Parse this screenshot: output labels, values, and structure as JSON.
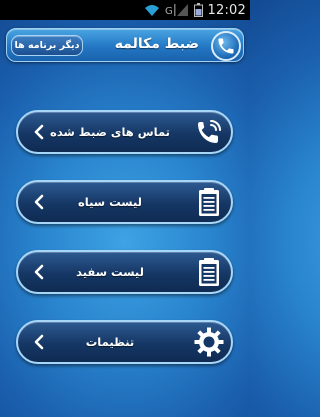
{
  "status_bar": {
    "time": "12:02",
    "icons": [
      "wifi-icon",
      "signal-icon",
      "battery-icon"
    ]
  },
  "header": {
    "title": "ضبط مکالمه",
    "more_apps_label": "دیگر برنامه ها",
    "logo_icon": "phone-logo-icon"
  },
  "menu": {
    "items": [
      {
        "label": "تماس های ضبط شده",
        "icon": "phone-icon"
      },
      {
        "label": "لیست سیاه",
        "icon": "clipboard-icon"
      },
      {
        "label": "لیست سفید",
        "icon": "clipboard-icon"
      },
      {
        "label": "تنظیمات",
        "icon": "gear-icon"
      }
    ]
  },
  "colors": {
    "background": "#2a86cf",
    "button_fill": "#153765",
    "button_border": "#a8d6f7"
  }
}
